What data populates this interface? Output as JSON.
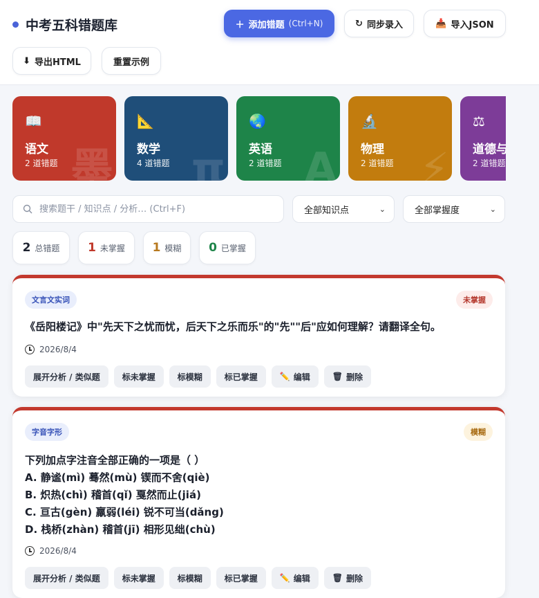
{
  "header": {
    "title": "中考五科错题库",
    "add_label": "添加错题",
    "add_shortcut": "(Ctrl+N)",
    "sync_label": "同步录入",
    "import_label": "导入JSON",
    "export_label": "导出HTML",
    "reset_label": "重置示例"
  },
  "subjects": [
    {
      "name": "语文",
      "count": "2 道错题",
      "icon": "book-icon",
      "glyph": "📖",
      "bg": "墨",
      "color": "#c0392b"
    },
    {
      "name": "数学",
      "count": "4 道错题",
      "icon": "triangle-ruler-icon",
      "glyph": "📐",
      "bg": "π",
      "color": "#1f4e79"
    },
    {
      "name": "英语",
      "count": "2 道错题",
      "icon": "globe-icon",
      "glyph": "🌏",
      "bg": "A",
      "color": "#1e8449"
    },
    {
      "name": "物理",
      "count": "2 道错题",
      "icon": "microscope-icon",
      "glyph": "🔬",
      "bg": "⚡",
      "color": "#c27c0e"
    },
    {
      "name": "道德与",
      "count": "2 道错题",
      "icon": "scale-icon",
      "glyph": "⚖",
      "bg": "",
      "color": "#7d3c98"
    }
  ],
  "filters": {
    "search_placeholder": "搜索题干 / 知识点 / 分析… (Ctrl+F)",
    "knowledge_selected": "全部知识点",
    "mastery_selected": "全部掌握度"
  },
  "stats": [
    {
      "num": "2",
      "label": "总错题",
      "color": "#1e2330"
    },
    {
      "num": "1",
      "label": "未掌握",
      "color": "#c0392b"
    },
    {
      "num": "1",
      "label": "模糊",
      "color": "#b7791f"
    },
    {
      "num": "0",
      "label": "已掌握",
      "color": "#1e8449"
    }
  ],
  "questions": [
    {
      "topic": "文言文实词",
      "status": "未掌握",
      "lines": [
        "《岳阳楼记》中\"先天下之忧而忧，后天下之乐而乐\"的\"先\"\"后\"应如何理解？请翻译全句。"
      ],
      "date": "2026/8/4"
    },
    {
      "topic": "字音字形",
      "status": "模糊",
      "lines": [
        "下列加点字注音全部正确的一项是（ ）",
        "A. 静谧(mì)  蓦然(mù)  锲而不舍(qiè)",
        "B. 炽热(chì) 稽首(qǐ)   戛然而止(jiá)",
        "C. 亘古(gèn) 羸弱(léi)  锐不可当(dǎng)",
        "D. 栈桥(zhàn) 稽首(jī)  相形见绌(chù)"
      ],
      "date": "2026/8/4"
    }
  ],
  "card_actions": {
    "expand": "展开分析 / 类似题",
    "mark_unmastered": "标未掌握",
    "mark_vague": "标模糊",
    "mark_mastered": "标已掌握",
    "edit": "编辑",
    "delete": "删除"
  }
}
